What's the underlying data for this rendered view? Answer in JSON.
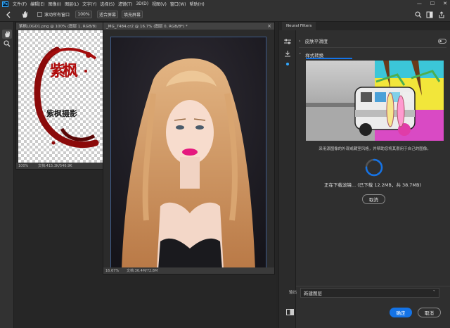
{
  "app": {
    "logo": "Ps"
  },
  "menu": [
    "文件(F)",
    "编辑(E)",
    "图像(I)",
    "图层(L)",
    "文字(Y)",
    "选择(S)",
    "滤镜(T)",
    "3D(D)",
    "视图(V)",
    "窗口(W)",
    "帮助(H)"
  ],
  "window_controls": {
    "minimize": "—",
    "maximize": "☐",
    "close": "✕"
  },
  "options": {
    "scroll_all_label": "滚动所有窗口",
    "zoom_100": "100%",
    "fit_screen": "适合屏幕",
    "fill_screen": "填充屏幕"
  },
  "doc1": {
    "tab": "紫枫LOGO1.png @ 100% (图层 1, RGB/8)",
    "zoom": "100%",
    "status": "文档:415.3K/546.9K",
    "logo_text": "紫枫摄影",
    "logo_char": "紫枫"
  },
  "doc2": {
    "tab": "_MG_7484.cr2 @ 16.7% (图层 0, RGB/8*) *",
    "zoom": "16.67%",
    "status": "文档:36.4M/72.8M"
  },
  "panel": {
    "tab": "Neural Filters",
    "filter1": "皮肤平滑度",
    "filter2": "样式转换",
    "description": "采用源图像的外观或藏室风格，并帮助您将其套用于自己的图像。",
    "downloading": "正在下载滤镜... (已下载 12.2MB，共 38.7MB)",
    "cancel_download": "取消",
    "progress": 0.75,
    "output_label": "输出",
    "output_value": "新建图层",
    "ok": "确定",
    "cancel": "取消"
  }
}
